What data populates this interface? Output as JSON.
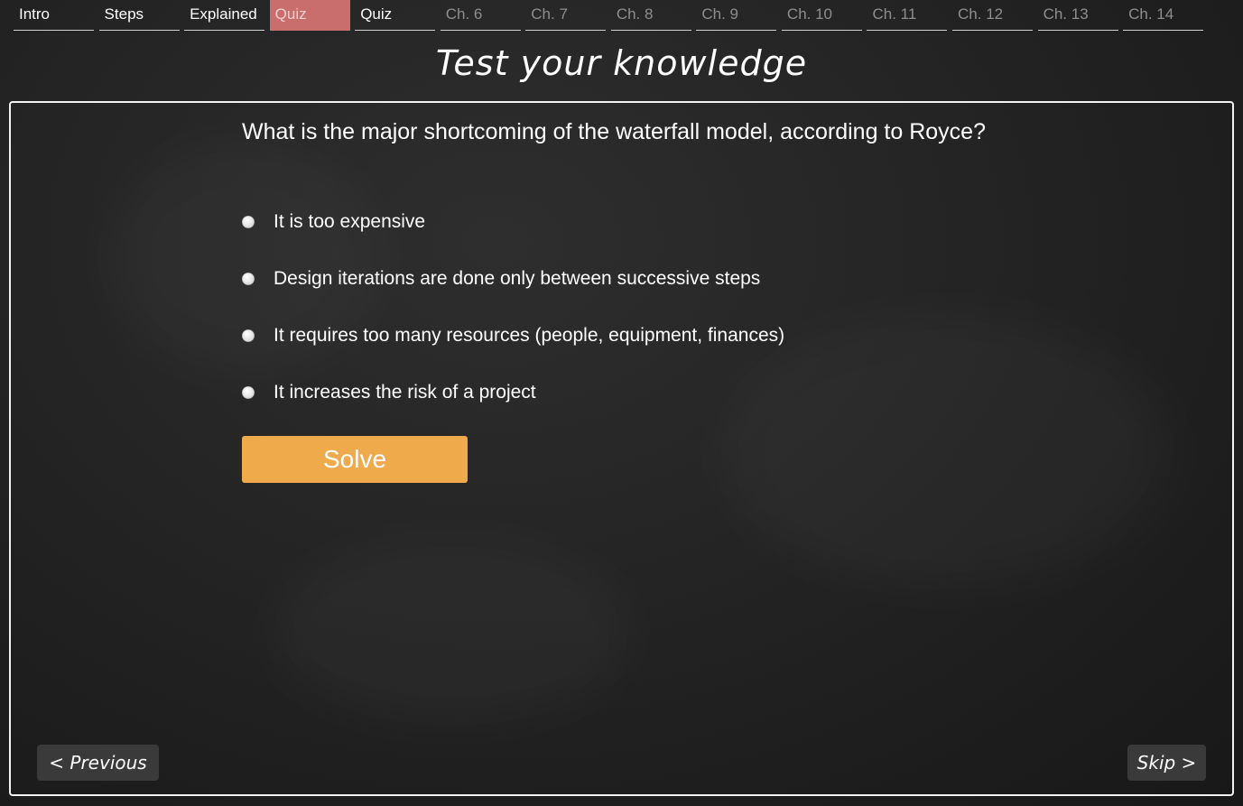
{
  "nav": {
    "tabs": [
      {
        "label": "Intro",
        "state": "done"
      },
      {
        "label": "Steps",
        "state": "done"
      },
      {
        "label": "Explained",
        "state": "done"
      },
      {
        "label": "Quiz",
        "state": "active"
      },
      {
        "label": "Quiz",
        "state": "done"
      },
      {
        "label": "Ch. 6",
        "state": "locked"
      },
      {
        "label": "Ch. 7",
        "state": "locked"
      },
      {
        "label": "Ch. 8",
        "state": "locked"
      },
      {
        "label": "Ch. 9",
        "state": "locked"
      },
      {
        "label": "Ch. 10",
        "state": "locked"
      },
      {
        "label": "Ch. 11",
        "state": "locked"
      },
      {
        "label": "Ch. 12",
        "state": "locked"
      },
      {
        "label": "Ch. 13",
        "state": "locked"
      },
      {
        "label": "Ch. 14",
        "state": "locked"
      }
    ]
  },
  "heading": "Test your knowledge",
  "quiz": {
    "question": "What is the major shortcoming of the waterfall model, according to Royce?",
    "options": [
      "It is too expensive",
      "Design iterations are done only between successive steps",
      "It requires too many resources (people, equipment, finances)",
      "It increases the risk of a project"
    ],
    "solve_label": "Solve"
  },
  "footer": {
    "previous_label": "< Previous",
    "skip_label": "Skip >"
  },
  "colors": {
    "active_tab": "#c96d6d",
    "solve_button": "#efaa4b",
    "locked_tab_text": "#8e8e8e"
  }
}
